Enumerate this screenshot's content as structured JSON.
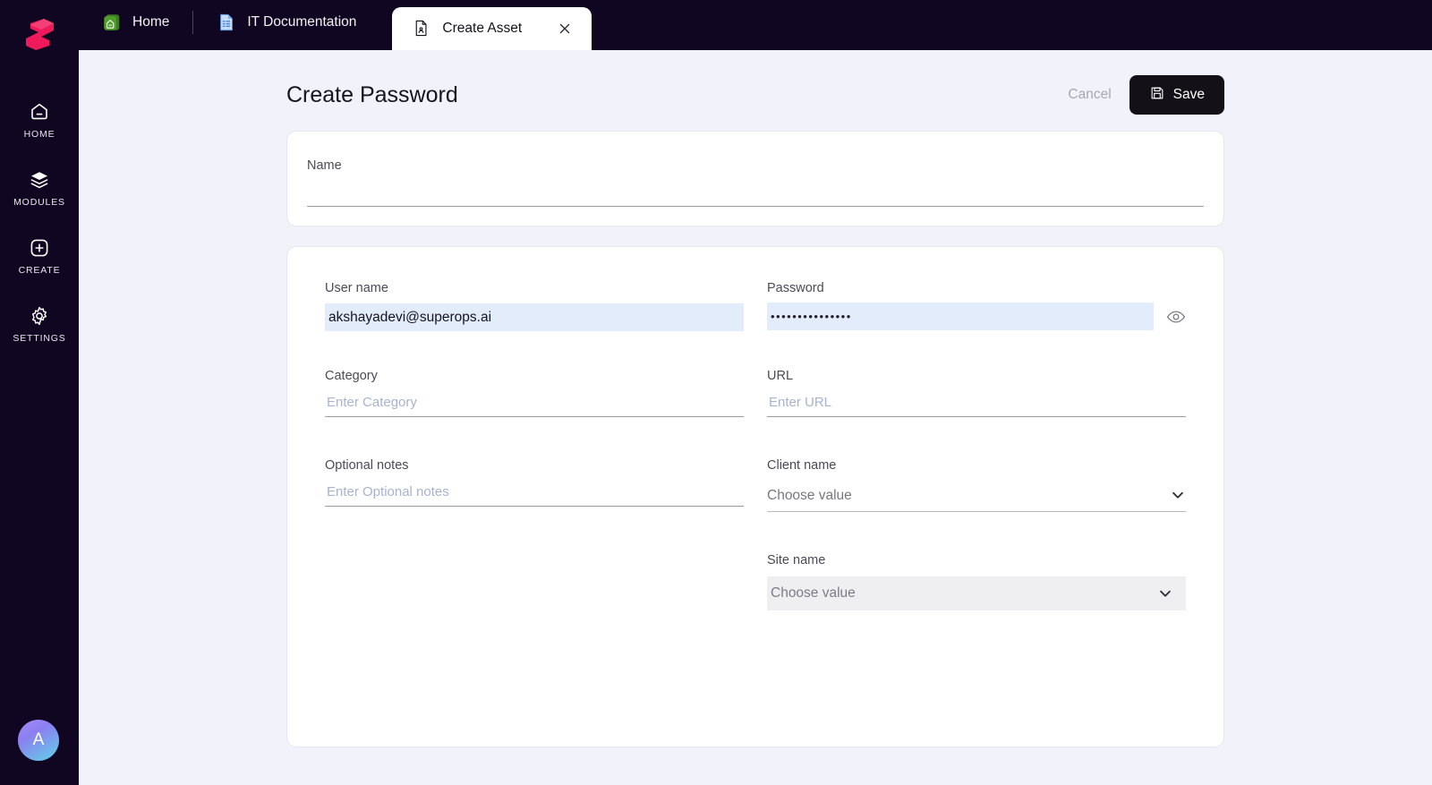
{
  "brand": {
    "logo_name": "superops-logo",
    "color": "#ef1a5b"
  },
  "sidebar": {
    "items": [
      {
        "icon": "home-icon",
        "label": "HOME"
      },
      {
        "icon": "layers-icon",
        "label": "MODULES"
      },
      {
        "icon": "plus-box-icon",
        "label": "CREATE"
      },
      {
        "icon": "gear-icon",
        "label": "SETTINGS"
      }
    ],
    "avatar": {
      "initial": "A",
      "name": "user-avatar"
    }
  },
  "tabs": [
    {
      "label": "Home",
      "icon": "home-app-icon",
      "active": false
    },
    {
      "label": "IT Documentation",
      "icon": "document-icon",
      "active": false
    },
    {
      "label": "Create Asset",
      "icon": "asset-file-icon",
      "active": true,
      "close": "×"
    }
  ],
  "header": {
    "title": "Create Password",
    "cancel_label": "Cancel",
    "save_label": "Save",
    "save_icon": "floppy-disk-icon"
  },
  "form": {
    "name": {
      "label": "Name",
      "value": "",
      "placeholder": ""
    },
    "user_name": {
      "label": "User name",
      "value": "akshayadevi@superops.ai",
      "placeholder": ""
    },
    "password": {
      "label": "Password",
      "value": "•••••••••••••••",
      "toggle_icon": "eye-icon"
    },
    "category": {
      "label": "Category",
      "value": "",
      "placeholder": "Enter Category"
    },
    "url": {
      "label": "URL",
      "value": "",
      "placeholder": "Enter URL"
    },
    "optional_notes": {
      "label": "Optional notes",
      "value": "",
      "placeholder": "Enter Optional notes"
    },
    "client_name": {
      "label": "Client name",
      "value": "Choose value",
      "chevron": "chevron-down-icon"
    },
    "site_name": {
      "label": "Site name",
      "value": "Choose value",
      "chevron": "chevron-down-icon"
    }
  }
}
